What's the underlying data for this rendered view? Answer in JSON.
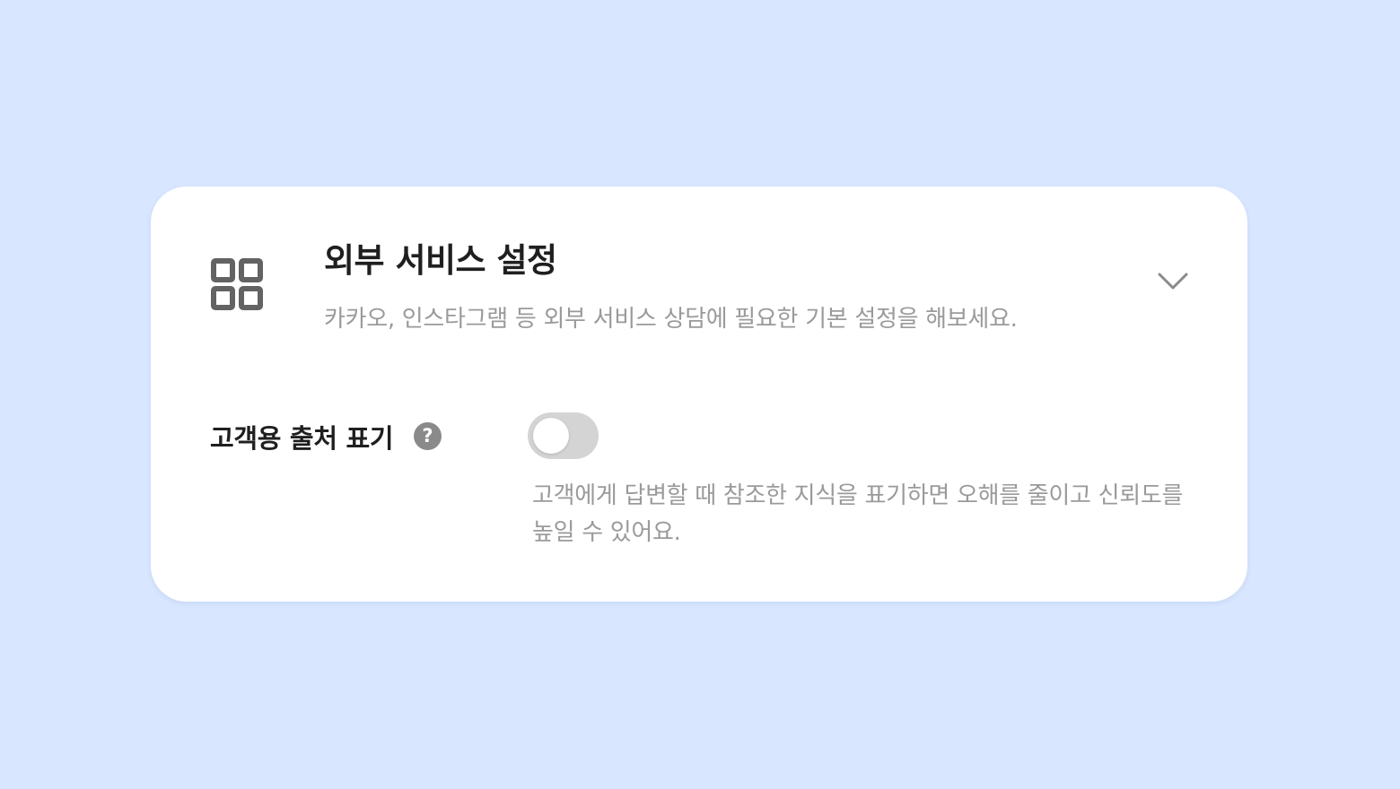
{
  "colors": {
    "page_background": "#d8e6ff",
    "card_background": "#ffffff",
    "title_text": "#1f1f1f",
    "muted_text": "#9a9a9a",
    "icon": "#636363",
    "toggle_off_track": "#d4d4d4"
  },
  "section": {
    "icon": "grid-icon",
    "title": "외부 서비스 설정",
    "subtitle": "카카오, 인스타그램 등 외부 서비스 상담에 필요한 기본 설정을 해보세요.",
    "expand_icon": "chevron-down-icon"
  },
  "setting": {
    "label": "고객용 출처 표기",
    "help_icon": "question-icon",
    "help_glyph": "?",
    "toggle_state": "off",
    "description": "고객에게 답변할 때 참조한 지식을 표기하면 오해를 줄이고 신뢰도를 높일 수 있어요."
  }
}
